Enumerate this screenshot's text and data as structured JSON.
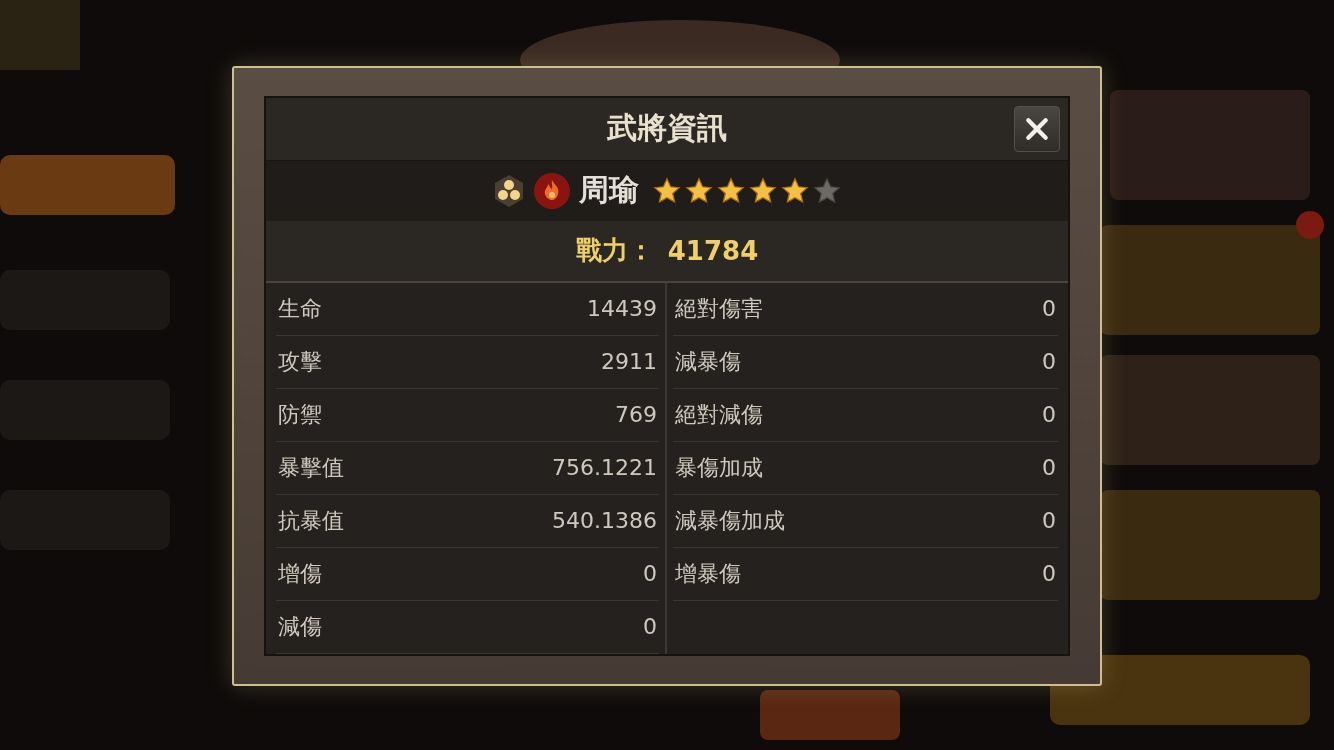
{
  "dialog": {
    "title": "武將資訊"
  },
  "hero": {
    "name": "周瑜",
    "stars": 5
  },
  "power": {
    "label": "戰力：",
    "value": "41784"
  },
  "stats": {
    "left": [
      {
        "label": "生命",
        "value": "14439"
      },
      {
        "label": "攻擊",
        "value": "2911"
      },
      {
        "label": "防禦",
        "value": "769"
      },
      {
        "label": "暴擊值",
        "value": "756.1221"
      },
      {
        "label": "抗暴值",
        "value": "540.1386"
      },
      {
        "label": "增傷",
        "value": "0"
      },
      {
        "label": "減傷",
        "value": "0"
      }
    ],
    "right": [
      {
        "label": "絕對傷害",
        "value": "0"
      },
      {
        "label": "減暴傷",
        "value": "0"
      },
      {
        "label": "絕對減傷",
        "value": "0"
      },
      {
        "label": "暴傷加成",
        "value": "0"
      },
      {
        "label": "減暴傷加成",
        "value": "0"
      },
      {
        "label": "增暴傷",
        "value": "0"
      }
    ]
  }
}
